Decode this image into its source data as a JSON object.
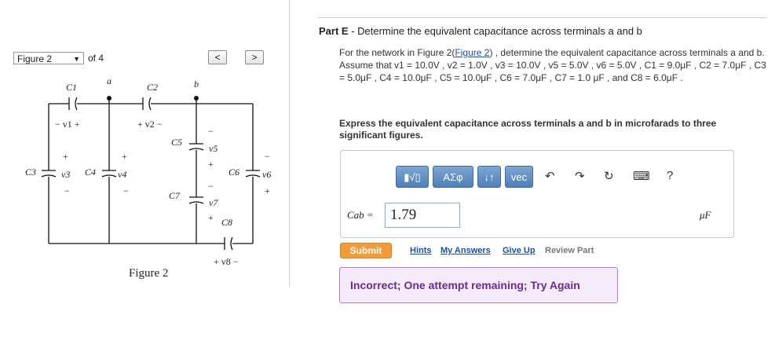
{
  "figure_nav": {
    "select_value": "Figure 2",
    "of_text": "of 4",
    "prev_symbol": "<",
    "next_symbol": ">"
  },
  "circuit": {
    "caption": "Figure 2",
    "labels": {
      "c1": "C1",
      "c2": "C2",
      "c3": "C3",
      "c4": "C4",
      "c5": "C5",
      "c6": "C6",
      "c7": "C7",
      "c8": "C8",
      "node_a": "a",
      "node_b": "b",
      "v1": "− v1 +",
      "v2": "+ v2 −",
      "v3": "v3",
      "v4": "v4",
      "v5": "v5",
      "v6": "v6",
      "v7": "v7",
      "v8": "+ v8 −"
    }
  },
  "part": {
    "title_bold": "Part E",
    "title_rest": " - Determine the equivalent capacitance across terminals a and b",
    "problem_intro": "For the network in Figure 2(",
    "problem_link": "Figure 2",
    "problem_body": ") , determine the equivalent capacitance across terminals a and b. Assume that v1 = 10.0V , v2 = 1.0V , v3 = 10.0V , v5 = 5.0V , v6 = 5.0V , C1 = 9.0μF , C2 = 7.0μF , C3 = 5.0μF , C4 = 10.0μF , C5 = 10.0μF , C6 = 7.0μF , C7 = 1.0 μF , and C8 = 6.0μF .",
    "express": "Express the equivalent capacitance across terminals a and b in microfarads to three significant figures."
  },
  "toolbar": {
    "templates": "▮√▯",
    "greek": "ΑΣφ",
    "arrows": "↓↑",
    "vec": "vec",
    "undo": "↶",
    "redo": "↷",
    "reset": "↻",
    "keyboard": "⌨",
    "help": "?"
  },
  "answer": {
    "label": "Cab =",
    "value": "1.79",
    "unit": "μF"
  },
  "actions": {
    "submit": "Submit",
    "hints": "Hints",
    "my_answers": "My Answers",
    "give_up": "Give Up",
    "review_part": "Review Part"
  },
  "feedback": {
    "text": "Incorrect; One attempt remaining; Try Again"
  }
}
